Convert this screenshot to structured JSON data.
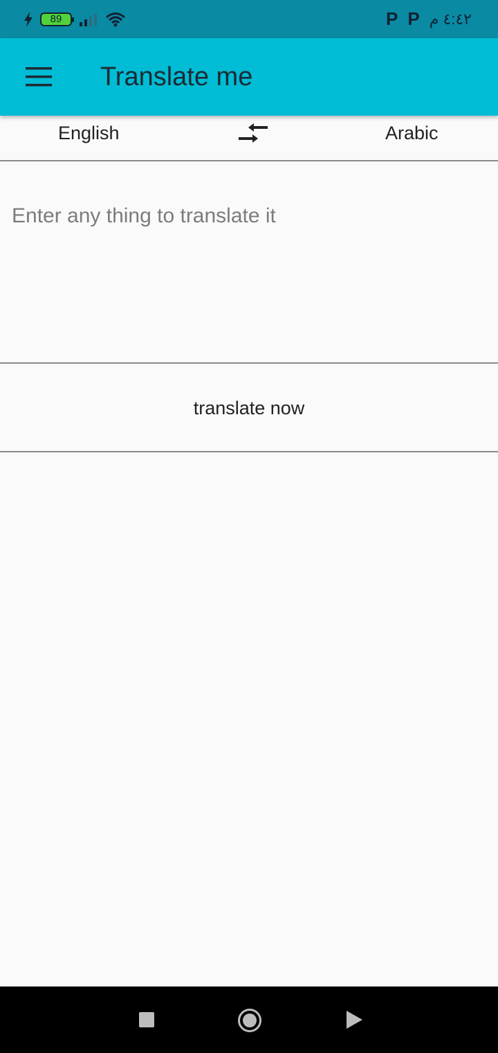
{
  "status_bar": {
    "battery_level": "89",
    "time": "٤:٤٢ م",
    "notification_letter_1": "P",
    "notification_letter_2": "P",
    "signal_bars": 2,
    "wifi": true
  },
  "app_bar": {
    "title": "Translate me",
    "menu_icon": "hamburger-menu-icon",
    "background": "#00bcd4"
  },
  "language_bar": {
    "source_language": "English",
    "target_language": "Arabic",
    "swap_icon": "swap-arrows-icon"
  },
  "input": {
    "placeholder": "Enter any thing to translate it",
    "value": ""
  },
  "actions": {
    "translate_label": "translate now"
  },
  "nav_bar": {
    "recent_icon": "recent-apps-icon",
    "home_icon": "home-icon",
    "back_icon": "back-icon"
  }
}
